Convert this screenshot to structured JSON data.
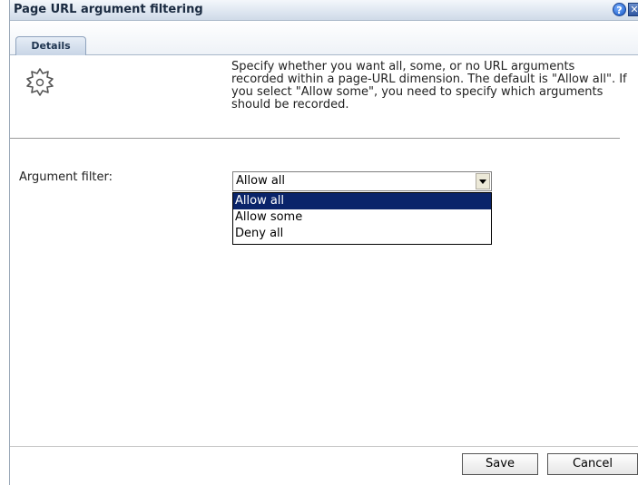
{
  "window": {
    "title": "Page URL argument filtering"
  },
  "tabs": [
    {
      "label": "Details"
    }
  ],
  "description": "Specify whether you want all, some, or no URL arguments recorded within a page-URL dimension. The default is \"Allow all\". If you select \"Allow some\", you need to specify which arguments should be recorded.",
  "form": {
    "argument_filter_label": "Argument filter:",
    "argument_filter_value": "Allow all",
    "options": [
      "Allow all",
      "Allow some",
      "Deny all"
    ],
    "selected_index": 0
  },
  "buttons": {
    "save_label": "Save",
    "cancel_label": "Cancel"
  },
  "icons": {
    "header": "gear-icon",
    "help": "help-icon",
    "close": "close-icon"
  },
  "colors": {
    "selection": "#0a246a",
    "titlebar": "#dfe7f1"
  }
}
